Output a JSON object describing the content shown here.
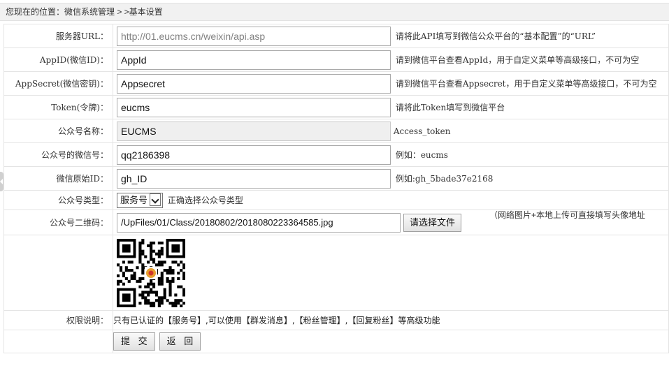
{
  "breadcrumb": {
    "text": "您现在的位置：微信系统管理 > >基本设置"
  },
  "form": {
    "server_url": {
      "label": "服务器URL：",
      "value": "http://01.eucms.cn/weixin/api.asp",
      "hint": "请将此API填写到微信公众平台的“基本配置”的“URL”"
    },
    "appid": {
      "label": "AppID(微信ID)：",
      "value": "AppId",
      "hint": "请到微信平台查看AppId，用于自定义菜单等高级接口，不可为空"
    },
    "appsecret": {
      "label": "AppSecret(微信密钥)：",
      "value": "Appsecret",
      "hint": "请到微信平台查看Appsecret，用于自定义菜单等高级接口，不可为空"
    },
    "token": {
      "label": "Token(令牌)：",
      "value": "eucms",
      "hint": "请将此Token填写到微信平台"
    },
    "account_name": {
      "label": "公众号名称：",
      "value": "EUCMS",
      "hint": "Access_token"
    },
    "wechat_id": {
      "label": "公众号的微信号：",
      "value": "qq2186398",
      "hint": "例如：eucms"
    },
    "original_id": {
      "label": "微信原始ID：",
      "value": "gh_ID",
      "hint": "例如:gh_5bade37e2168"
    },
    "account_type": {
      "label": "公众号类型：",
      "selected": "服务号",
      "hint": "正确选择公众号类型"
    },
    "qrcode": {
      "label": "公众号二维码：",
      "value": "/UpFiles/01/Class/20180802/2018080223364585.jpg",
      "choose_button": "请选择文件",
      "note": "（网络图片+本地上传可直接填写头像地址"
    },
    "permission": {
      "label": "权限说明：",
      "text": "只有已认证的【服务号】,可以使用【群发消息】,【粉丝管理】,【回复粉丝】等高级功能"
    },
    "buttons": {
      "submit": "提 交",
      "back": "返 回"
    }
  }
}
